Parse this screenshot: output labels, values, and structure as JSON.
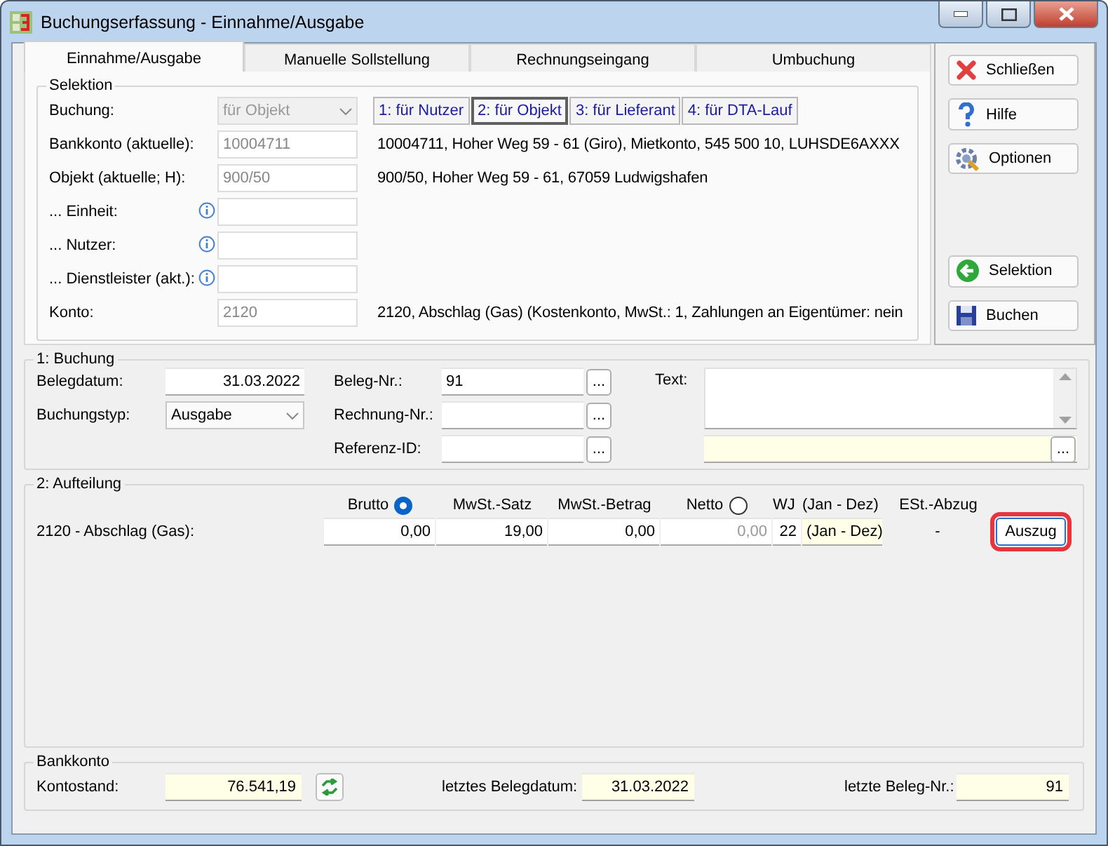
{
  "window": {
    "title": "Buchungserfassung - Einnahme/Ausgabe"
  },
  "tabs": [
    {
      "label": "Einnahme/Ausgabe",
      "selected": true
    },
    {
      "label": "Manuelle Sollstellung",
      "selected": false
    },
    {
      "label": "Rechnungseingang",
      "selected": false
    },
    {
      "label": "Umbuchung",
      "selected": false
    }
  ],
  "selektion": {
    "title": "Selektion",
    "rows": [
      {
        "label": "Buchung:",
        "kind": "combo",
        "value": "für Objekt",
        "info": false
      },
      {
        "label": "Bankkonto (aktuelle):",
        "kind": "field",
        "value": "10004711",
        "info": false,
        "text": "10004711,  Hoher Weg 59 - 61 (Giro),  Mietkonto,  545 500 10,  LUHSDE6AXXX"
      },
      {
        "label": "Objekt (aktuelle; H):",
        "kind": "field",
        "value": "900/50",
        "info": false,
        "text": "900/50,  Hoher Weg 59 - 61, 67059 Ludwigshafen"
      },
      {
        "label": "... Einheit:",
        "kind": "field",
        "info": true
      },
      {
        "label": "... Nutzer:",
        "kind": "field",
        "info": true
      },
      {
        "label": "... Dienstleister (akt.):",
        "kind": "field",
        "info": true
      },
      {
        "label": "Konto:",
        "kind": "field",
        "value": "2120",
        "info": false,
        "text": "2120,  Abschlag (Gas)  (Kostenkonto,  MwSt.: 1,  Zahlungen an Eigentümer: nein"
      }
    ],
    "mode_buttons": [
      {
        "label": "1: für Nutzer",
        "selected": false
      },
      {
        "label": "2: für Objekt",
        "selected": true
      },
      {
        "label": "3: für Lieferant",
        "selected": false
      },
      {
        "label": "4: für DTA-Lauf",
        "selected": false
      }
    ]
  },
  "top_buttons": [
    {
      "label": "Schließen"
    },
    {
      "label": "Hilfe"
    },
    {
      "label": "Optionen"
    }
  ],
  "bottom_buttons": [
    {
      "label": "Selektion"
    },
    {
      "label": "Buchen"
    }
  ],
  "buchung": {
    "title": "1: Buchung",
    "belegdatum": {
      "label": "Belegdatum:",
      "value": "31.03.2022"
    },
    "buchungstyp": {
      "label": "Buchungstyp:",
      "value": "Ausgabe"
    },
    "refs": [
      {
        "label": "Beleg-Nr.:",
        "value": "91",
        "button": "..."
      },
      {
        "label": "Rechnung-Nr.:",
        "button": "..."
      },
      {
        "label": "Referenz-ID:",
        "button": "..."
      }
    ],
    "text_label": "Text:",
    "text_button": "..."
  },
  "aufteilung": {
    "title": "2: Aufteilung",
    "columns": [
      {
        "label": "Brutto",
        "kind": "radio",
        "selected": true
      },
      {
        "label": "MwSt.-Satz",
        "kind": "text"
      },
      {
        "label": "MwSt.-Betrag",
        "kind": "text"
      },
      {
        "label": "Netto",
        "kind": "radio",
        "selected": false
      },
      {
        "label": "WJ",
        "kind": "text"
      },
      {
        "label": "(Jan - Dez)",
        "kind": "text"
      },
      {
        "label": "ESt.-Abzug",
        "kind": "text"
      }
    ],
    "row": {
      "label": "2120 - Abschlag (Gas):",
      "cells": [
        {
          "value": "0,00",
          "kind": "input"
        },
        {
          "value": "19,00",
          "kind": "input"
        },
        {
          "value": "0,00",
          "kind": "input"
        },
        {
          "value": "0,00",
          "kind": "readonly"
        },
        {
          "value": "22",
          "kind": "input"
        },
        {
          "value": "(Jan - Dez)",
          "kind": "yellow"
        },
        {
          "value": "-",
          "kind": "static"
        }
      ]
    },
    "button": {
      "label": "Auszug",
      "highlighted": true
    }
  },
  "bankkonto": {
    "title": "Bankkonto",
    "fields": [
      {
        "label": "Kontostand:",
        "value": "76.541,19",
        "refresh": true
      },
      {
        "label": "letztes Belegdatum:",
        "value": "31.03.2022",
        "refresh": false
      },
      {
        "label": "letzte Beleg-Nr.:",
        "value": "91",
        "refresh": false
      }
    ]
  }
}
